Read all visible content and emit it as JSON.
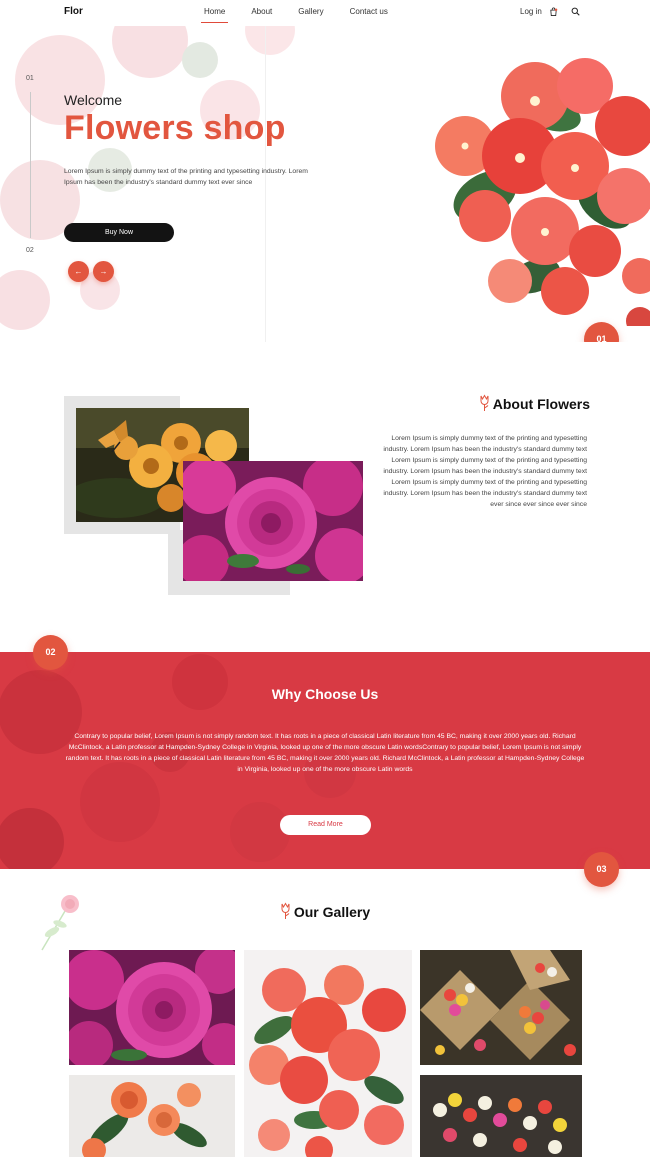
{
  "nav": {
    "logo": "Flor",
    "links": [
      "Home",
      "About",
      "Gallery",
      "Contact us"
    ],
    "active": "Home",
    "login": "Log in",
    "icons": [
      "shopping-bag-icon",
      "search-icon"
    ]
  },
  "hero": {
    "slide_numbers": [
      "01",
      "02"
    ],
    "welcome": "Welcome",
    "title": "Flowers shop",
    "text": "Lorem Ipsum is simply dummy text of the printing and typesetting industry. Lorem Ipsum has been the industry's standard dummy text ever since",
    "buy_button": "Buy Now",
    "prev_icon": "arrow-left-icon",
    "next_icon": "arrow-right-icon",
    "prev_glyph": "←",
    "next_glyph": "→",
    "badge": "01"
  },
  "about": {
    "title": "About Flowers",
    "text": "Lorem Ipsum is simply dummy text of the printing and typesetting industry. Lorem Ipsum has been the industry's standard dummy text Lorem Ipsum is simply dummy text of the printing and typesetting industry. Lorem Ipsum has been the industry's standard dummy text Lorem Ipsum is simply dummy text of the printing and typesetting industry. Lorem Ipsum has been the industry's standard dummy text ever since ever since ever since"
  },
  "why": {
    "badge": "02",
    "title": "Why Choose Us",
    "text": "Contrary to popular belief, Lorem Ipsum is not simply random text. It has roots in a piece of classical Latin literature from 45 BC, making it over 2000 years old. Richard McClintock, a Latin professor at Hampden-Sydney College in Virginia, looked up one of the more obscure Latin wordsContrary to popular belief, Lorem Ipsum is not simply random text. It has roots in a piece of classical Latin literature from 45 BC, making it over 2000 years old. Richard McClintock, a Latin professor at Hampden-Sydney College in Virginia, looked up one of the more obscure Latin words",
    "button": "Read More"
  },
  "gallery": {
    "badge": "03",
    "title": "Our Gallery"
  },
  "colors": {
    "accent": "#e2563f",
    "band": "#d83a44",
    "dark": "#131313"
  }
}
